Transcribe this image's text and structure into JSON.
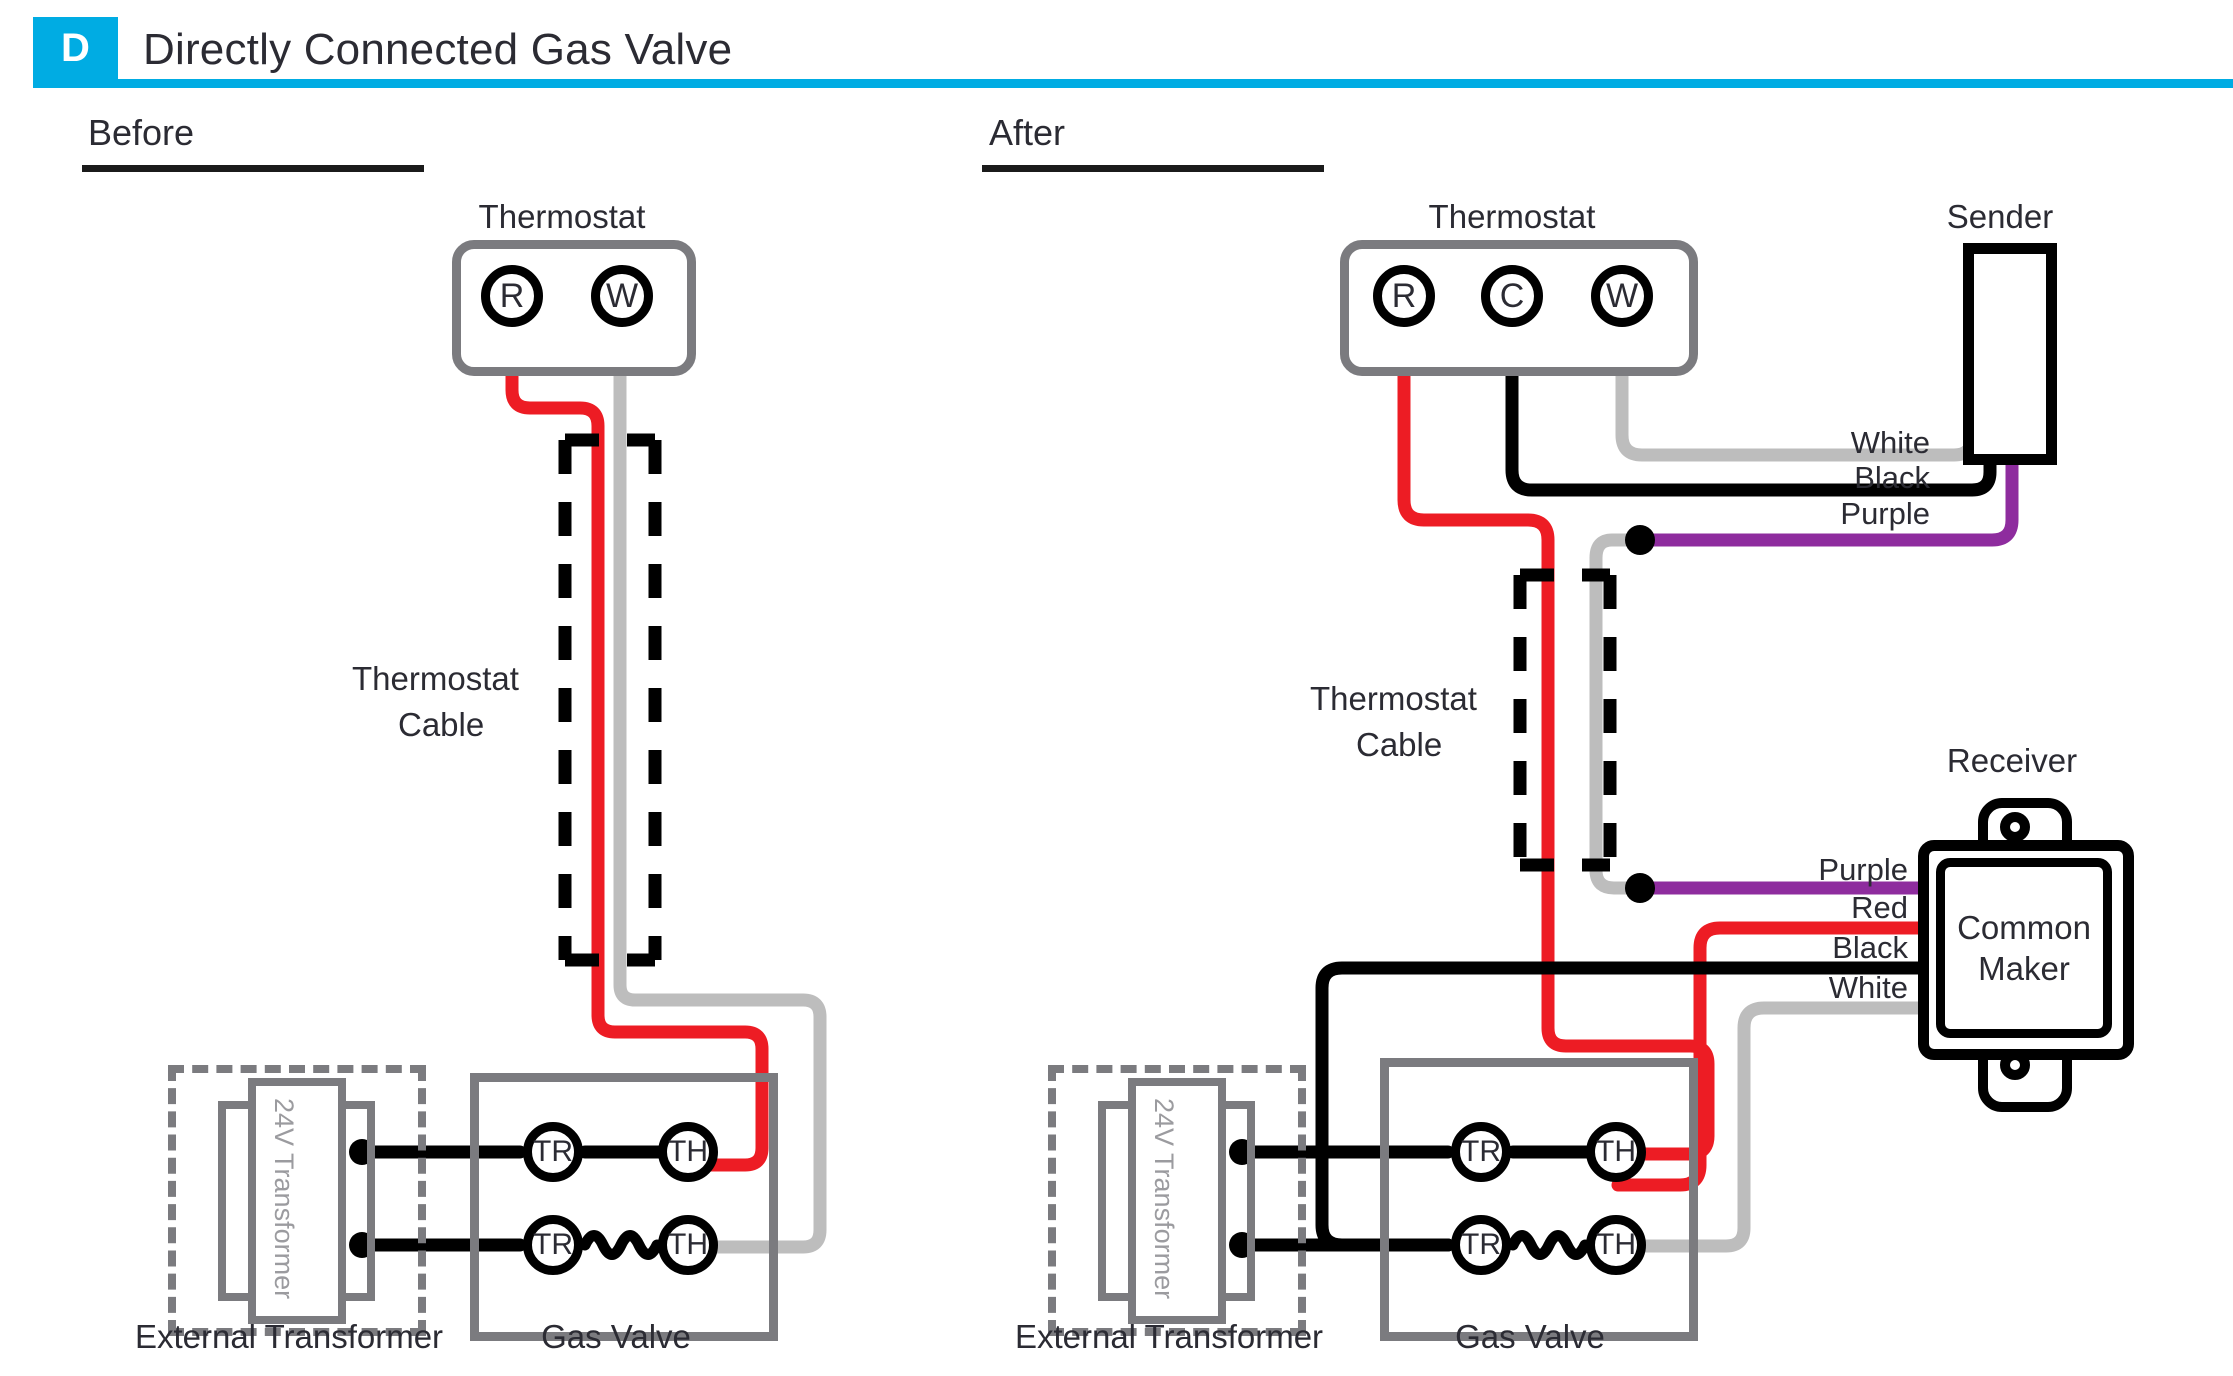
{
  "header": {
    "badge_letter": "D",
    "title": "Directly Connected Gas Valve",
    "accent_color": "#00ACE3"
  },
  "colors": {
    "red": "#ED1C24",
    "black": "#000000",
    "gray_wire": "#BDBDBD",
    "purple": "#8E2C9E",
    "outline_gray": "#7B7B7F",
    "text": "#2B2B33"
  },
  "sections": [
    {
      "label": "Before"
    },
    {
      "label": "After"
    }
  ],
  "before": {
    "thermostat_label": "Thermostat",
    "thermostat_terminals": [
      "R",
      "W"
    ],
    "cable_label_line1": "Thermostat",
    "cable_label_line2": "Cable",
    "transformer_label": "External Transformer",
    "transformer_text": "24V Transformer",
    "gas_valve_label": "Gas Valve",
    "gas_valve_terminals": [
      "TR",
      "TH",
      "TR",
      "TH"
    ]
  },
  "after": {
    "thermostat_label": "Thermostat",
    "thermostat_terminals": [
      "R",
      "C",
      "W"
    ],
    "sender_label": "Sender",
    "receiver_label": "Receiver",
    "receiver_name_line1": "Common",
    "receiver_name_line2": "Maker",
    "cable_label_line1": "Thermostat",
    "cable_label_line2": "Cable",
    "transformer_label": "External Transformer",
    "transformer_text": "24V Transformer",
    "gas_valve_label": "Gas Valve",
    "gas_valve_terminals": [
      "TR",
      "TH",
      "TR",
      "TH"
    ],
    "sender_wire_labels": [
      "White",
      "Black",
      "Purple"
    ],
    "receiver_wire_labels": [
      "Purple",
      "Red",
      "Black",
      "White"
    ]
  }
}
